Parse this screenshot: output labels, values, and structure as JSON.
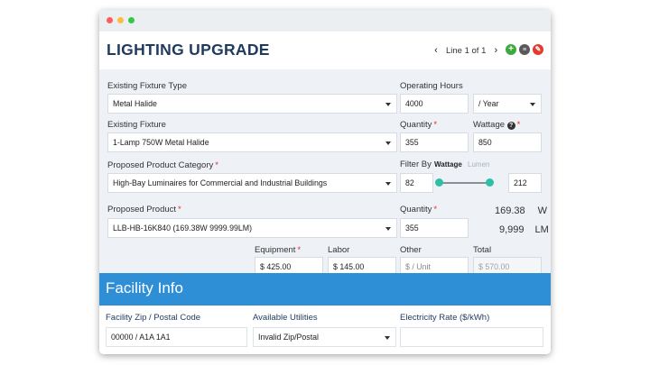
{
  "header": {
    "title": "LIGHTING UPGRADE",
    "pager": {
      "prev": "‹",
      "text": "Line 1 of 1",
      "next": "›"
    },
    "actions": {
      "add": "+",
      "list": "≡",
      "delete": "✎"
    }
  },
  "form": {
    "existing_fixture_type": {
      "label": "Existing Fixture Type",
      "value": "Metal Halide"
    },
    "operating_hours": {
      "label": "Operating Hours",
      "value": "4000",
      "period": "/ Year"
    },
    "existing_fixture": {
      "label": "Existing Fixture",
      "value": "1-Lamp 750W Metal Halide"
    },
    "existing_quantity": {
      "label": "Quantity",
      "required": "*",
      "value": "355"
    },
    "wattage": {
      "label": "Wattage",
      "help": "?",
      "required": "*",
      "value": "850"
    },
    "proposed_category": {
      "label": "Proposed Product Category",
      "required": "*",
      "value": "High-Bay Luminaires for Commercial and Industrial Buildings"
    },
    "filter": {
      "label": "Filter By",
      "tabs": [
        "Wattage",
        "Lumen"
      ],
      "active_tab": "Wattage",
      "min": "82",
      "max": "212",
      "range_fraction": [
        0.0,
        1.0
      ]
    },
    "proposed_product": {
      "label": "Proposed Product",
      "required": "*",
      "value": "LLB-HB-16K840 (169.38W 9999.99LM)"
    },
    "proposed_quantity": {
      "label": "Quantity",
      "required": "*",
      "value": "355"
    },
    "output": {
      "watts": "169.38",
      "watts_unit": "W",
      "lumens": "9,999",
      "lumens_unit": "LM"
    },
    "costs": {
      "equipment": {
        "label": "Equipment",
        "required": "*",
        "value": "$ 425.00"
      },
      "labor": {
        "label": "Labor",
        "value": "$ 145.00"
      },
      "other": {
        "label": "Other",
        "placeholder": "$ / Unit"
      },
      "total": {
        "label": "Total",
        "value": "$ 570.00"
      }
    }
  },
  "facility": {
    "title": "Facility Info",
    "zip": {
      "label": "Facility Zip / Postal Code",
      "value": "00000 / A1A 1A1"
    },
    "utilities": {
      "label": "Available Utilities",
      "value": "Invalid Zip/Postal"
    },
    "rate": {
      "label": "Electricity Rate ($/kWh)",
      "value": ""
    }
  },
  "colors": {
    "title": "#1f3a5f",
    "banner": "#2e8fd6",
    "required": "#e0322b",
    "slider_handle": "#2ebfa6",
    "add_button": "#3daa3d",
    "delete_button": "#e23b2e"
  }
}
